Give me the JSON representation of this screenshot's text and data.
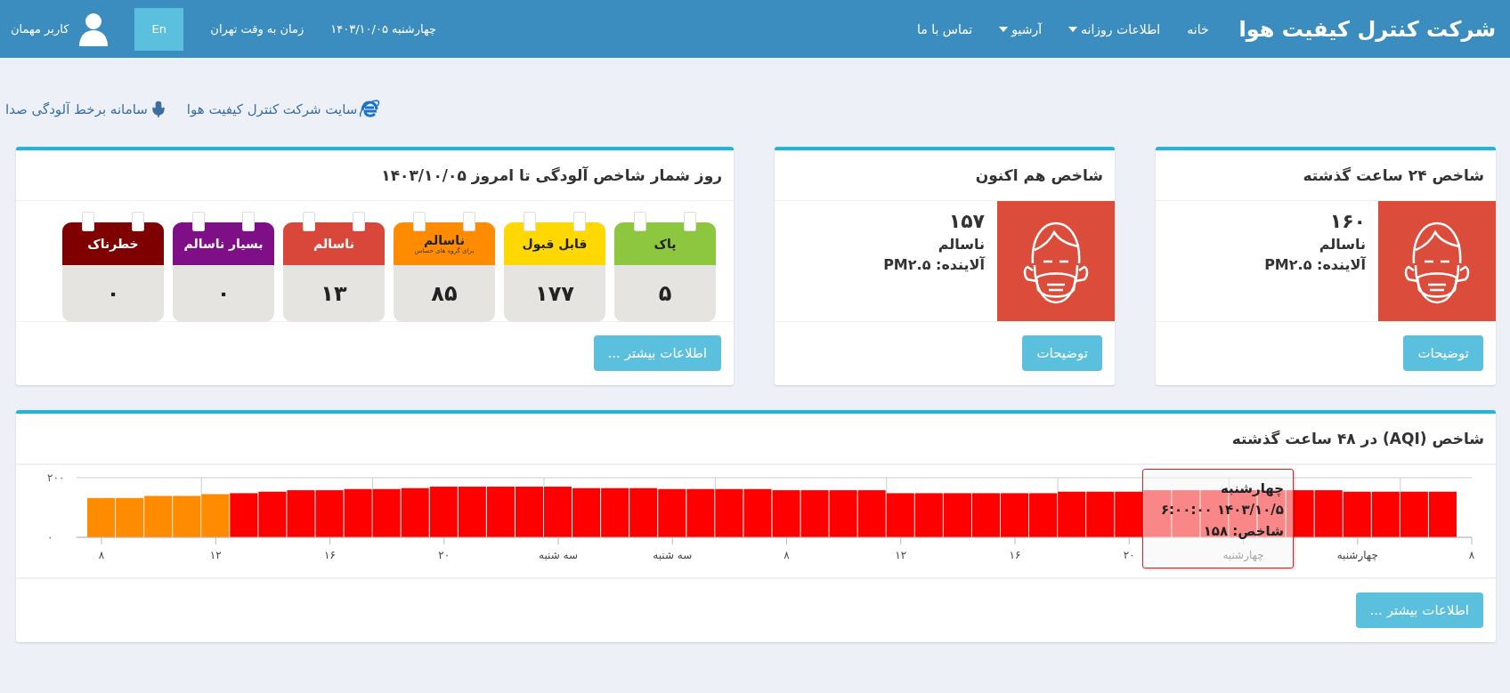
{
  "header": {
    "title": "شرکت کنترل کیفیت هوا",
    "nav": [
      {
        "label": "خانه",
        "dropdown": false
      },
      {
        "label": "اطلاعات روزانه",
        "dropdown": true
      },
      {
        "label": "آرشیو",
        "dropdown": true
      },
      {
        "label": "تماس با ما",
        "dropdown": false
      }
    ],
    "date": "چهارشنبه ۱۴۰۳/۱۰/۰۵",
    "timezone": "زمان به وقت تهران",
    "language_button": "En",
    "user": "کاربر مهمان"
  },
  "links": [
    {
      "kind": "browser",
      "label": "سایت شرکت کنترل کیفیت هوا"
    },
    {
      "kind": "mic",
      "label": "سامانه برخط آلودگی صدا"
    }
  ],
  "index_cards": [
    {
      "title": "شاخص ۲۴ ساعت گذشته",
      "value": "۱۶۰",
      "status": "ناسالم",
      "pollutant": "آلاینده: PM۲.۵",
      "button": "توضیحات"
    },
    {
      "title": "شاخص هم اکنون",
      "value": "۱۵۷",
      "status": "ناسالم",
      "pollutant": "آلاینده: PM۲.۵",
      "button": "توضیحات"
    }
  ],
  "counter": {
    "title": "روز شمار شاخص آلودگی تا امروز ۱۴۰۳/۱۰/۰۵",
    "items": [
      {
        "label": "پاک",
        "value": "۵",
        "color": "#8dc63f"
      },
      {
        "label": "قابل قبول",
        "value": "۱۷۷",
        "color": "#ffd800"
      },
      {
        "label": "ناسالم",
        "sublabel": "برای گروه های حساس",
        "value": "۸۵",
        "color": "#ff8c00"
      },
      {
        "label": "ناسالم",
        "value": "۱۳",
        "color": "#d9463a"
      },
      {
        "label": "بسیار ناسالم",
        "value": "۰",
        "color": "#7f0f86"
      },
      {
        "label": "خطرناک",
        "value": "۰",
        "color": "#7e0000"
      }
    ],
    "button": "اطلاعات بیشتر ..."
  },
  "aqi_chart": {
    "title": "شاخص (AQI) در ۴۸ ساعت گذشته",
    "chart_data": {
      "type": "bar",
      "ylim": [
        0,
        200
      ],
      "yticks": [
        {
          "value": 0,
          "label": "۰"
        },
        {
          "value": 200,
          "label": "۲۰۰"
        }
      ],
      "categories": [
        "۸",
        null,
        null,
        null,
        "۱۲",
        null,
        null,
        null,
        "۱۶",
        null,
        null,
        null,
        "۲۰",
        null,
        null,
        null,
        "سه شنبه",
        null,
        null,
        null,
        "سه شنبه",
        null,
        null,
        null,
        "۸",
        null,
        null,
        null,
        "۱۲",
        null,
        null,
        null,
        "۱۶",
        null,
        null,
        null,
        "۲۰",
        null,
        null,
        null,
        "چهارشنبه",
        null,
        null,
        null,
        "چهارشنبه",
        null,
        null,
        null,
        "۸"
      ],
      "series": [
        {
          "color": "#ff8c00",
          "values": [
            132,
            132,
            139,
            139,
            145,
            null,
            null,
            null,
            null,
            null,
            null,
            null,
            null,
            null,
            null,
            null,
            null,
            null,
            null,
            null,
            null,
            null,
            null,
            null,
            null,
            null,
            null,
            null,
            null,
            null,
            null,
            null,
            null,
            null,
            null,
            null,
            null,
            null,
            null,
            null,
            null,
            null,
            null,
            null,
            null,
            null,
            null,
            null,
            null
          ]
        },
        {
          "color": "#ff0000",
          "values": [
            null,
            null,
            null,
            null,
            null,
            148,
            153,
            158,
            158,
            162,
            162,
            165,
            170,
            170,
            170,
            170,
            170,
            165,
            165,
            165,
            162,
            162,
            162,
            162,
            158,
            158,
            158,
            158,
            148,
            148,
            148,
            148,
            148,
            148,
            153,
            153,
            153,
            158,
            158,
            158,
            158,
            158,
            158,
            158,
            153,
            153,
            153,
            153,
            null
          ]
        }
      ]
    },
    "tooltip": {
      "day": "چهارشنبه",
      "datetime": "۱۴۰۳/۱۰/۵ ۶:۰۰:۰۰",
      "value": "شاخص: ۱۵۸"
    },
    "button": "اطلاعات بیشتر ..."
  }
}
